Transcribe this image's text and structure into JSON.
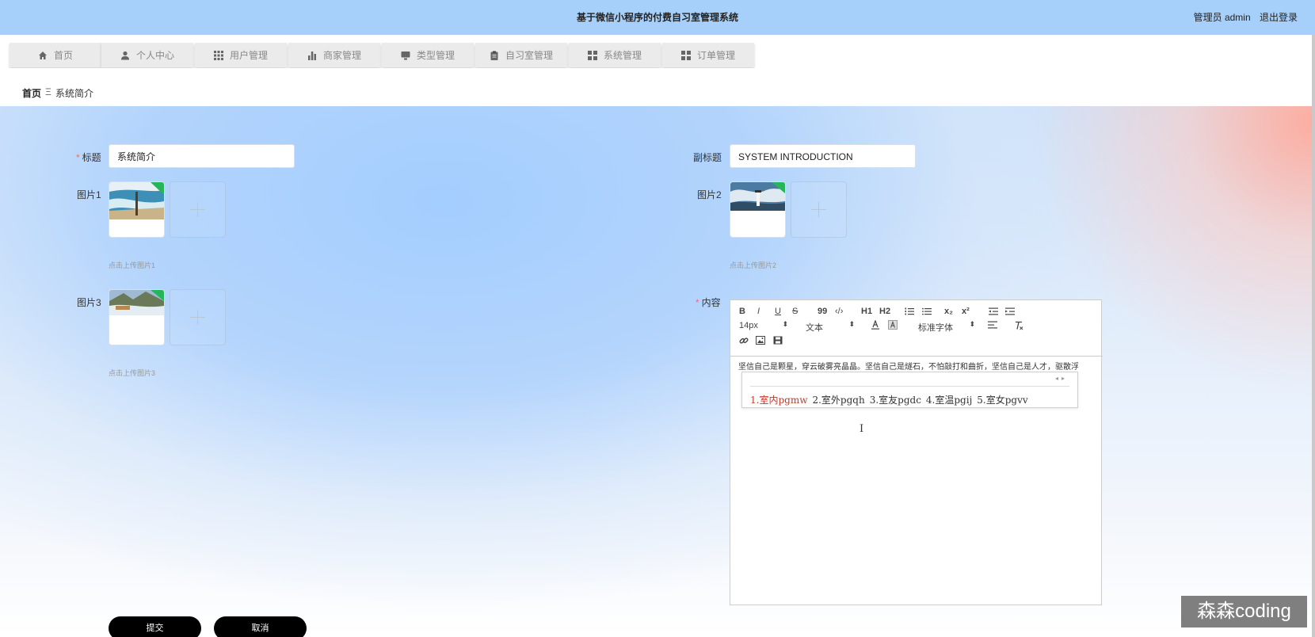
{
  "header": {
    "title": "基于微信小程序的付费自习室管理系统",
    "user_label": "管理员 admin",
    "logout_label": "退出登录"
  },
  "nav": {
    "tabs": [
      {
        "label": "首页",
        "icon": "home-icon"
      },
      {
        "label": "个人中心",
        "icon": "user-icon"
      },
      {
        "label": "用户管理",
        "icon": "grid-icon"
      },
      {
        "label": "商家管理",
        "icon": "bar-chart-icon"
      },
      {
        "label": "类型管理",
        "icon": "monitor-icon"
      },
      {
        "label": "自习室管理",
        "icon": "clipboard-icon"
      },
      {
        "label": "系统管理",
        "icon": "apps-icon"
      },
      {
        "label": "订单管理",
        "icon": "apps-icon"
      }
    ]
  },
  "breadcrumb": {
    "home": "首页",
    "separator": "Ξ",
    "current": "系统简介"
  },
  "form": {
    "title_label": "标题",
    "title_value": "系统简介",
    "subtitle_label": "副标题",
    "subtitle_value": "SYSTEM INTRODUCTION",
    "pic1_label": "图片1",
    "pic1_hint": "点击上传图片1",
    "pic2_label": "图片2",
    "pic2_hint": "点击上传图片2",
    "pic3_label": "图片3",
    "pic3_hint": "点击上传图片3",
    "content_label": "内容"
  },
  "editor": {
    "toolbar": {
      "bold": "B",
      "italic": "I",
      "underline": "U",
      "strike": "S",
      "quote": "99",
      "code": "‹/›",
      "h1": "H1",
      "h2": "H2",
      "sub": "x₂",
      "sup": "x²",
      "size": "14px",
      "header": "文本",
      "font": "标准字体"
    },
    "content": "坚信自己是颗星，穿云破雾亮晶晶。坚信自己是燧石，不怕敲打和曲折，坚信自己是人才，驱散浮",
    "ime_candidates": [
      "1.室内pgmw",
      "2.室外pgqh",
      "3.室友pgdc",
      "4.室温pgij",
      "5.室女pgvv"
    ]
  },
  "buttons": {
    "submit": "提交",
    "cancel": "取消"
  },
  "watermark": "森森coding"
}
